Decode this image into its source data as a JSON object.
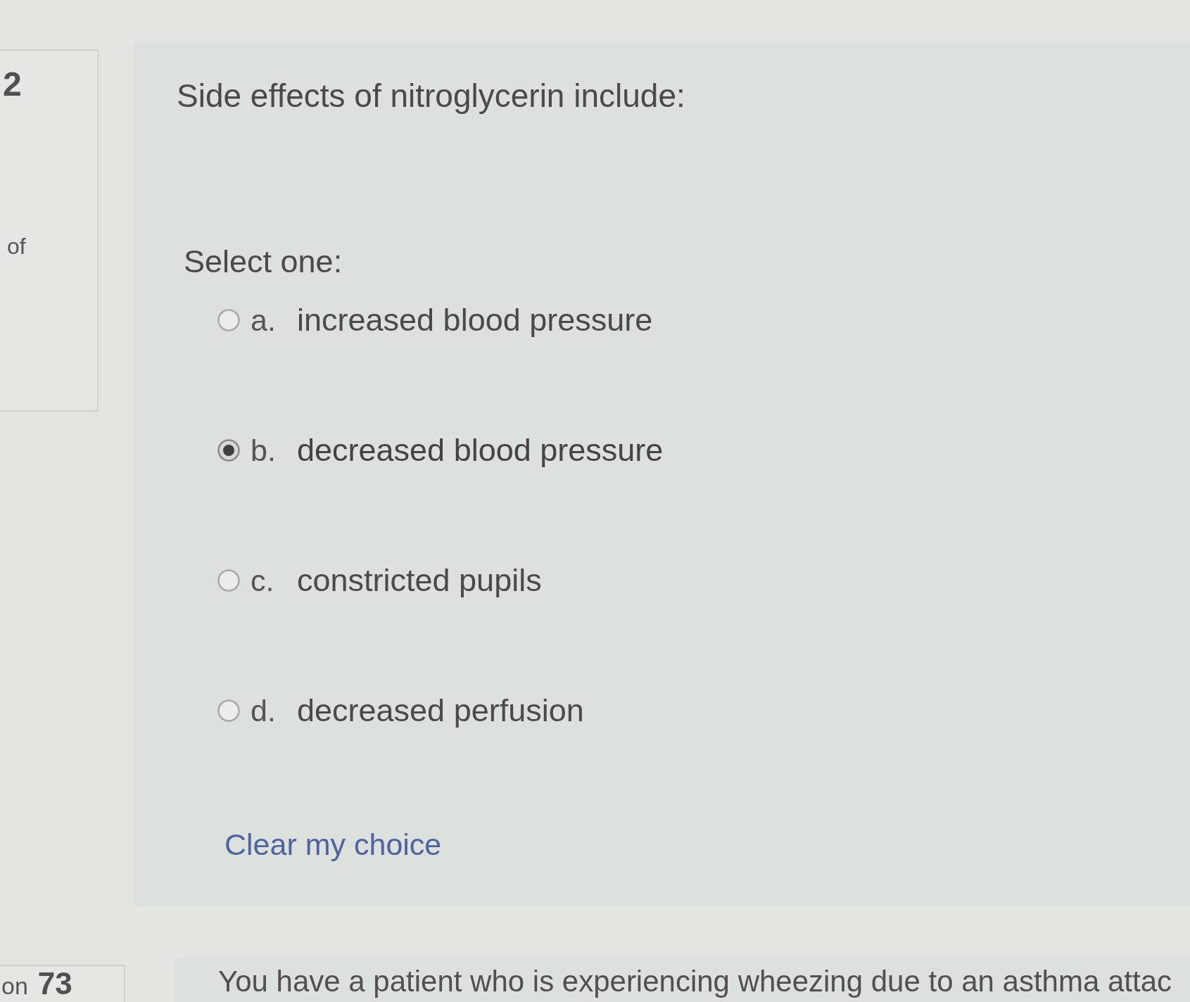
{
  "info_panel": {
    "number": "2",
    "text": "of"
  },
  "question": {
    "text": "Side effects of nitroglycerin include:",
    "prompt": "Select one:",
    "options": [
      {
        "letter": "a.",
        "label": "increased blood pressure",
        "selected": false
      },
      {
        "letter": "b.",
        "label": "decreased blood pressure",
        "selected": true
      },
      {
        "letter": "c.",
        "label": "constricted pupils",
        "selected": false
      },
      {
        "letter": "d.",
        "label": "decreased perfusion",
        "selected": false
      }
    ],
    "clear_link": "Clear my choice"
  },
  "next_info_panel": {
    "prefix": "on",
    "number": "73"
  },
  "next_question": {
    "text": "You have a patient who is experiencing wheezing due to an asthma attac"
  }
}
